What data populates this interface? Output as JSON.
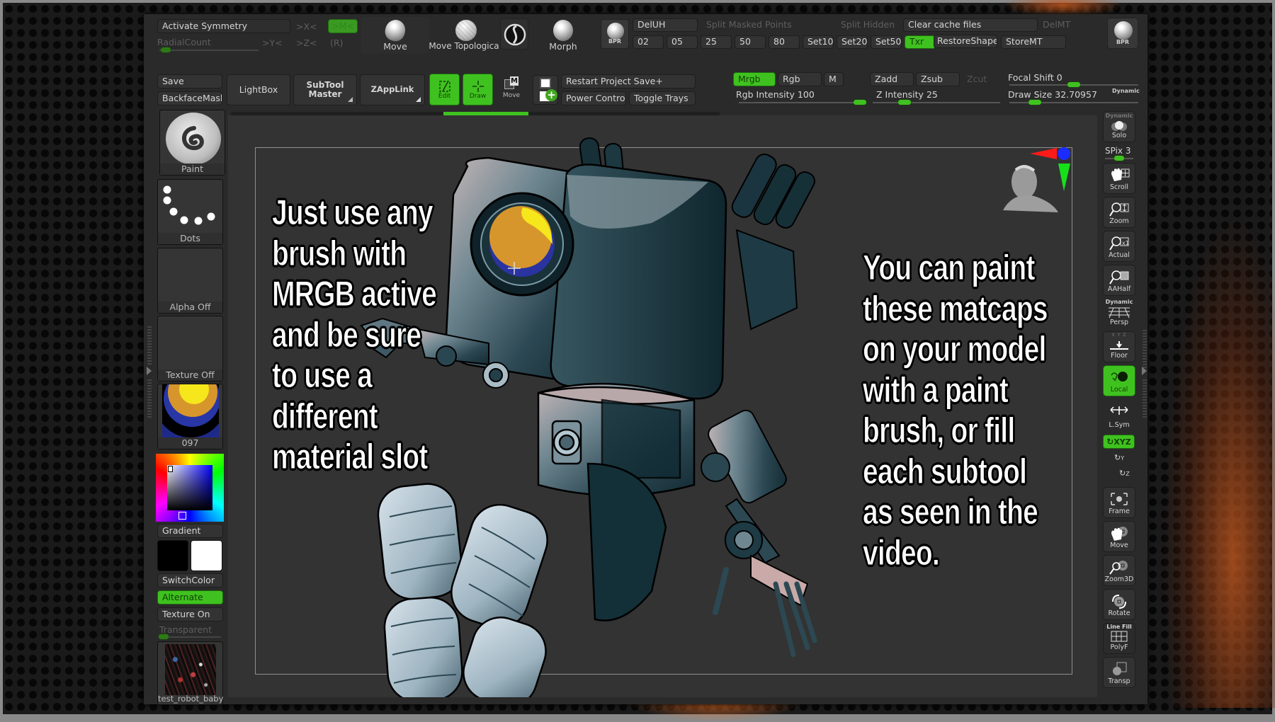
{
  "app": "ZBrush",
  "colors": {
    "accent_green": "#3fc21f",
    "panel_bg": "#2a2a2a",
    "button_bg": "#333333",
    "canvas_bg": "#333333",
    "axis_red": "#ff1a1a",
    "axis_green": "#16e01a",
    "axis_blue": "#1a2cff"
  },
  "top_row": {
    "activate_symmetry": "Activate Symmetry",
    "x_sym": ">X<",
    "m_sym": ">M<",
    "radial_count": "RadialCount",
    "y_sym": ">Y<",
    "z_sym": ">Z<",
    "r_sym": "(R)",
    "move_brush": "Move",
    "move_topological_brush": "Move Topologica",
    "morph_brush": "Morph",
    "bpr": "BPR",
    "del_uh": "DelUH",
    "split_masked_points": "Split Masked Points",
    "split_hidden": "Split Hidden",
    "clear_cache_files": "Clear cache files",
    "del_mt": "DelMT",
    "presets": [
      "02",
      "05",
      "25",
      "50",
      "80"
    ],
    "set10": "Set10",
    "set20": "Set20",
    "set50": "Set50",
    "txr": "Txr",
    "restore_shape": "RestoreShape",
    "store_mt": "StoreMT"
  },
  "second_row": {
    "save": "Save",
    "backface_mask": "BackfaceMask",
    "lightbox": "LightBox",
    "subtool_master_line1": "SubTool",
    "subtool_master_line2": "Master",
    "zapplink": "ZAppLink",
    "edit": "Edit",
    "draw": "Draw",
    "move": "Move",
    "move_badge": "M",
    "restart_project_save": "Restart Project Save+",
    "power_control": "Power Control",
    "toggle_trays": "Toggle Trays",
    "mrgb": "Mrgb",
    "rgb": "Rgb",
    "m": "M",
    "zadd": "Zadd",
    "zsub": "Zsub",
    "zcut": "Zcut",
    "rgb_intensity_label": "Rgb Intensity",
    "rgb_intensity_value": "100",
    "z_intensity_label": "Z Intensity",
    "z_intensity_value": "25",
    "focal_shift_label": "Focal Shift",
    "focal_shift_value": "0",
    "draw_size_label": "Draw Size",
    "draw_size_value": "32.70957",
    "dynamic": "Dynamic"
  },
  "sliders": {
    "radial_count_fraction": 0.05,
    "rgb_intensity_fraction": 1.0,
    "z_intensity_fraction": 0.25,
    "focal_shift_fraction": 0.5,
    "draw_size_fraction": 0.2,
    "transparent_fraction": 0.05,
    "spix_fraction": 0.5,
    "tray_progress_fraction": 0.5
  },
  "left_panel": {
    "brush": "Paint",
    "stroke": "Dots",
    "alpha": "Alpha Off",
    "texture": "Texture Off",
    "material": "097",
    "gradient": "Gradient",
    "switch_color": "SwitchColor",
    "alternate": "Alternate",
    "texture_on": "Texture On",
    "transparent": "Transparent",
    "tool_name": "test_robot_baby",
    "primary_color": "#000000",
    "secondary_color": "#ffffff",
    "picker_color": "#0000cc"
  },
  "right_shelf": {
    "dynamic_top": "Dynamic",
    "solo": "Solo",
    "spix_label": "SPix",
    "spix_value": "3",
    "scroll": "Scroll",
    "zoom": "Zoom",
    "actual": "Actual",
    "aahalf": "AAHalf",
    "persp_top": "Dynamic",
    "persp": "Persp",
    "floor_axes": "X Y Z",
    "floor": "Floor",
    "local": "Local",
    "lsym": "L.Sym",
    "xyz": "XYZ",
    "rot_y": "Y",
    "rot_z": "Z",
    "frame": "Frame",
    "move": "Move",
    "zoom3d": "Zoom3D",
    "rotate": "Rotate",
    "line_fill": "Line Fill",
    "polyf": "PolyF",
    "transp": "Transp"
  },
  "canvas": {
    "left_caption": "Just use any\nbrush with\nMRGB active\nand be sure\nto use a\ndifferent\nmaterial slot",
    "right_caption": "You can paint\nthese matcaps\non your model\nwith a paint\nbrush, or fill\neach subtool\nas seen in the\nvideo."
  }
}
